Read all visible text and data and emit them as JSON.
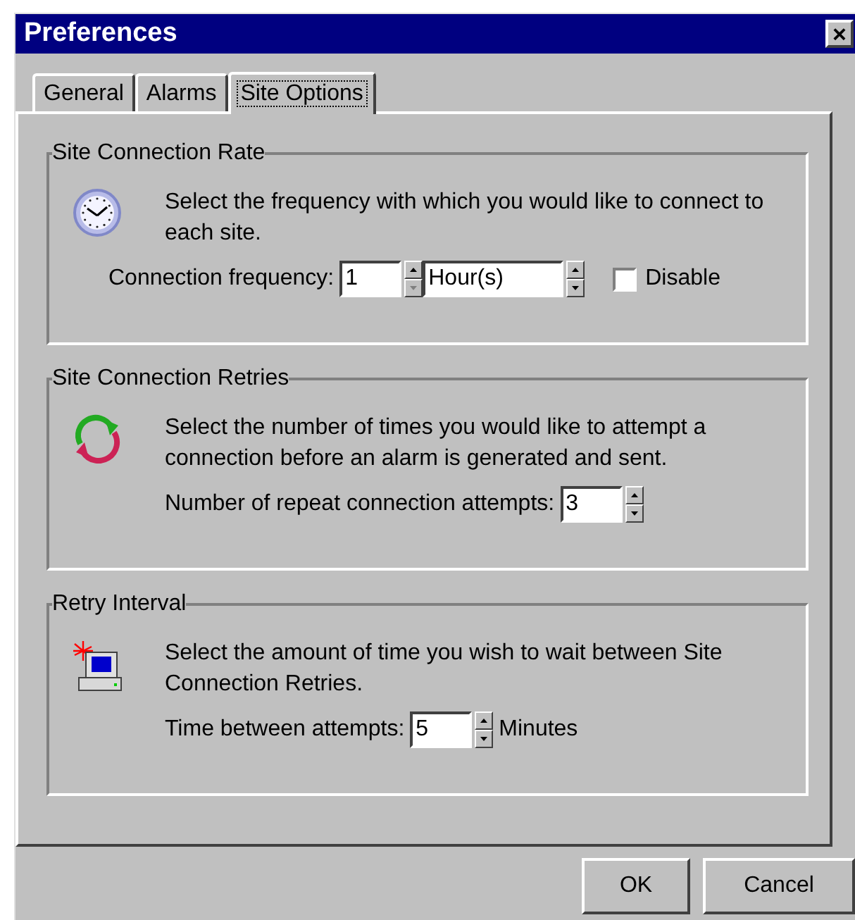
{
  "window": {
    "title": "Preferences",
    "close": "×"
  },
  "tabs": [
    {
      "label": "General",
      "selected": false
    },
    {
      "label": "Alarms",
      "selected": false
    },
    {
      "label": "Site Options",
      "selected": true
    }
  ],
  "groups": [
    {
      "title": "Site Connection Rate",
      "description": "Select the frequency with which you would like to connect to each site.",
      "controls": [
        {
          "kind": "label",
          "text": "Connection frequency:"
        },
        {
          "kind": "spinner",
          "value": "1",
          "down_disabled": true
        },
        {
          "kind": "spinner",
          "value": "Hour(s)",
          "down_disabled": false
        },
        {
          "kind": "checkbox",
          "label": "Disable",
          "checked": false
        }
      ]
    },
    {
      "title": "Site Connection Retries",
      "description": "Select the number of times you would like to attempt a connection before an alarm is generated and sent.",
      "controls": [
        {
          "kind": "label",
          "text": "Number of repeat connection attempts:"
        },
        {
          "kind": "spinner",
          "value": "3",
          "down_disabled": false
        }
      ]
    },
    {
      "title": "Retry Interval",
      "description": "Select the amount of time you wish to wait between Site Connection Retries.",
      "controls": [
        {
          "kind": "label",
          "text": "Time between attempts:"
        },
        {
          "kind": "spinner",
          "value": "5",
          "down_disabled": false
        },
        {
          "kind": "text",
          "text": "Minutes"
        }
      ]
    }
  ],
  "buttons": [
    "OK",
    "Cancel"
  ]
}
